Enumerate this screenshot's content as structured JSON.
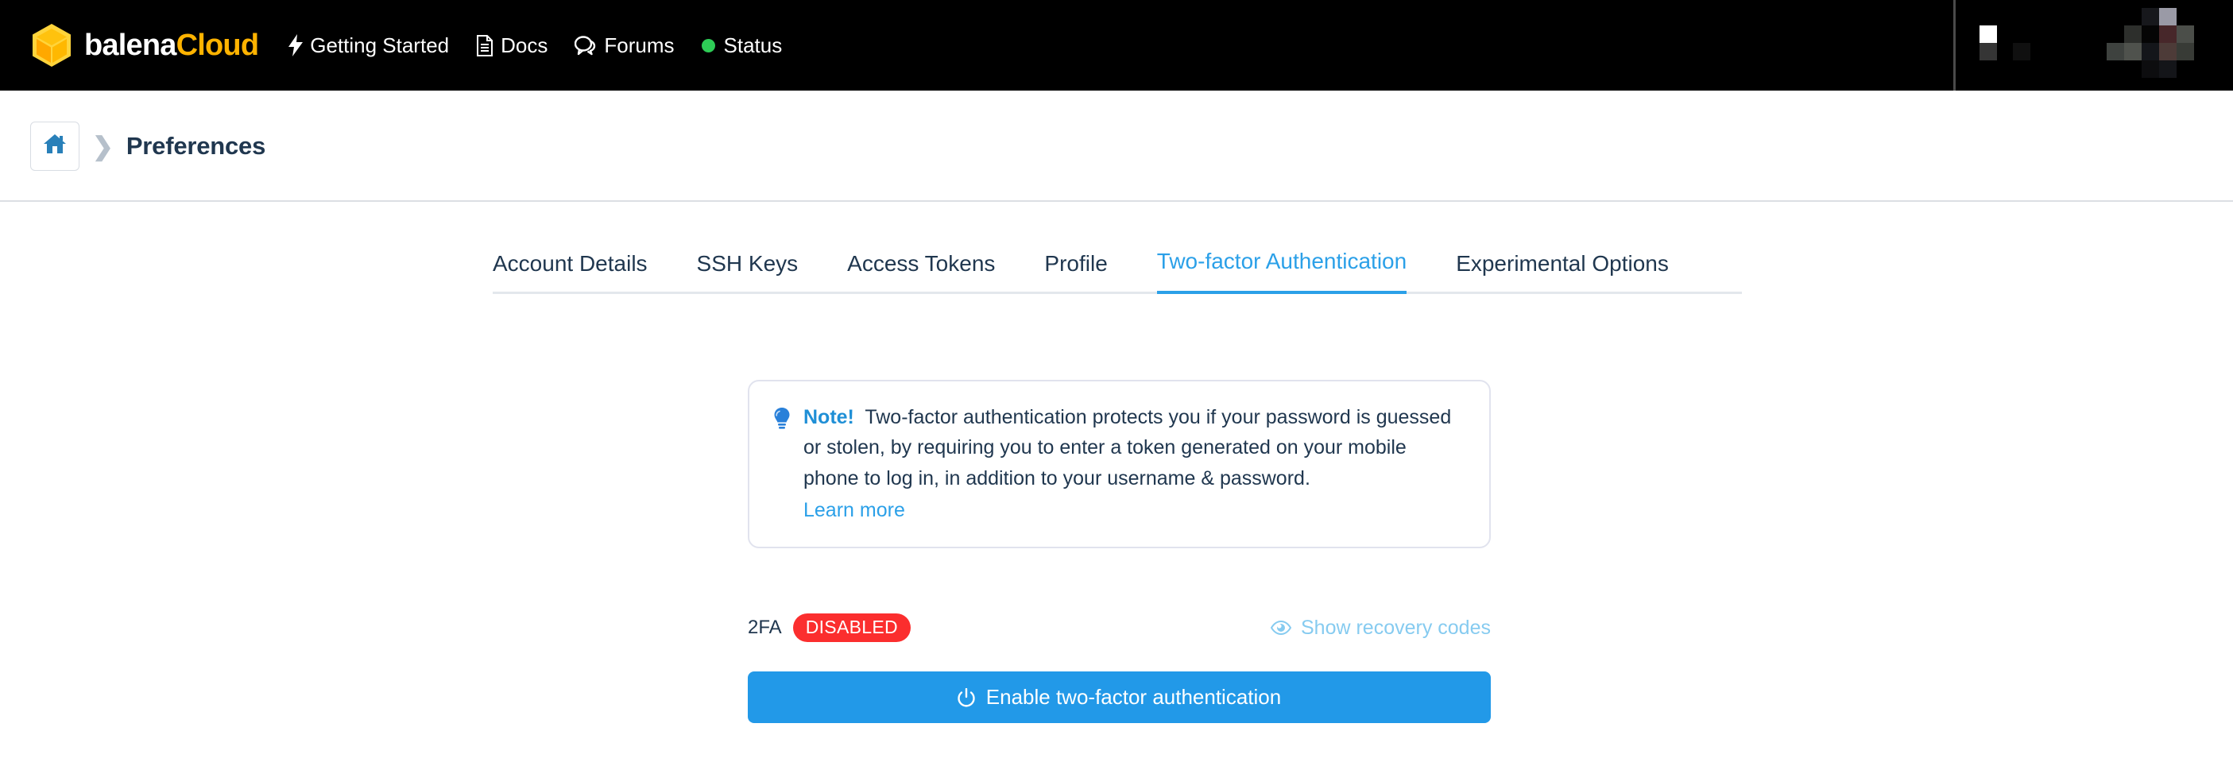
{
  "brand": {
    "logo_icon": "balena-cube-icon",
    "name_first": "balena",
    "name_second": "Cloud",
    "cube_color": "#ffc20e",
    "cloud_color": "#ffb300"
  },
  "topnav": {
    "items": [
      {
        "label": "Getting Started",
        "icon": "bolt-icon"
      },
      {
        "label": "Docs",
        "icon": "document-icon"
      },
      {
        "label": "Forums",
        "icon": "chat-bubbles-icon"
      },
      {
        "label": "Status",
        "icon": "status-dot-icon",
        "dot_color": "#2ecc56"
      }
    ],
    "background": "#000000"
  },
  "breadcrumb": {
    "home_icon": "home-icon",
    "separator": "❯",
    "title": "Preferences"
  },
  "tabs": {
    "items": [
      {
        "label": "Account Details",
        "active": false
      },
      {
        "label": "SSH Keys",
        "active": false
      },
      {
        "label": "Access Tokens",
        "active": false
      },
      {
        "label": "Profile",
        "active": false
      },
      {
        "label": "Two-factor Authentication",
        "active": true
      },
      {
        "label": "Experimental Options",
        "active": false
      }
    ],
    "active_color": "#2ba0e8"
  },
  "note": {
    "icon": "lightbulb-icon",
    "label": "Note!",
    "text": "Two-factor authentication protects you if your password is guessed or stolen, by requiring you to enter a token generated on your mobile phone to log in, in addition to your username & password.",
    "link_label": "Learn more"
  },
  "status": {
    "label": "2FA",
    "badge": "DISABLED",
    "badge_color": "#fb2e2e",
    "recovery_icon": "eye-icon",
    "recovery_label": "Show recovery codes"
  },
  "primary_action": {
    "icon": "power-icon",
    "label": "Enable two-factor authentication",
    "color": "#2299e8"
  }
}
